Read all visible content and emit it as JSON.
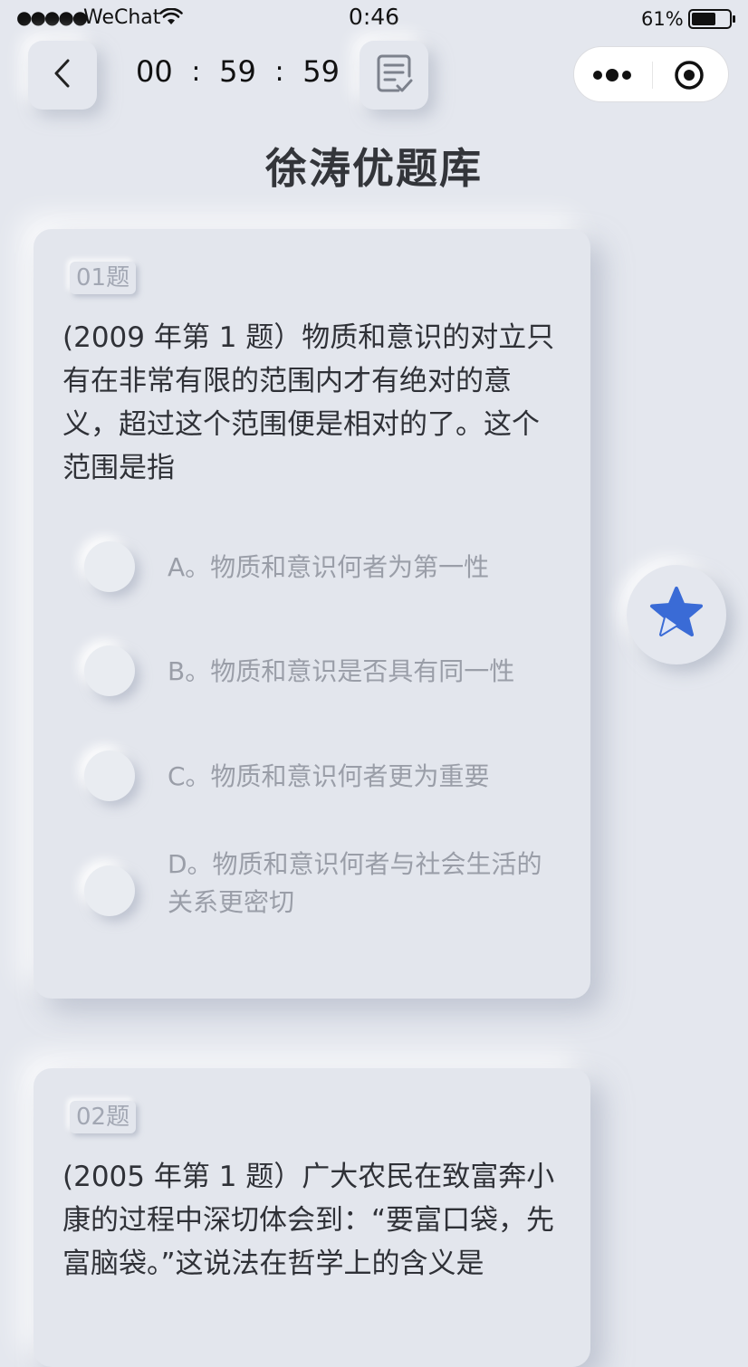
{
  "status_bar": {
    "signal": "●●●●●",
    "carrier": "WeChat",
    "time": "0:46",
    "battery": "61%",
    "wifi_icon": "wifi-icon",
    "battery_icon": "battery-icon"
  },
  "header": {
    "back_icon": "chevron-left-icon",
    "timer": {
      "hours": "00",
      "minutes": "59",
      "seconds": "59",
      "separator": ":"
    },
    "answer_sheet_icon": "answer-sheet-icon",
    "capsule": {
      "more_icon": "more-icon",
      "close_icon": "target-icon"
    }
  },
  "page": {
    "title": "徐涛优题库"
  },
  "questions": [
    {
      "number": "01题",
      "text": "(2009 年第 1 题）物质和意识的对立只有在非常有限的范围内才有绝对的意义，超过这个范围便是相对的了。这个范围是指",
      "options": [
        "A。物质和意识何者为第一性",
        "B。物质和意识是否具有同一性",
        "C。物质和意识何者更为重要",
        "D。物质和意识何者与社会生活的关系更密切"
      ]
    },
    {
      "number": "02题",
      "text": "(2005 年第 1 题）广大农民在致富奔小康的过程中深切体会到：“要富口袋，先富脑袋。”这说法在哲学上的含义是"
    }
  ],
  "favorite": {
    "icon": "star-icon",
    "color": "#3a6bd6"
  }
}
